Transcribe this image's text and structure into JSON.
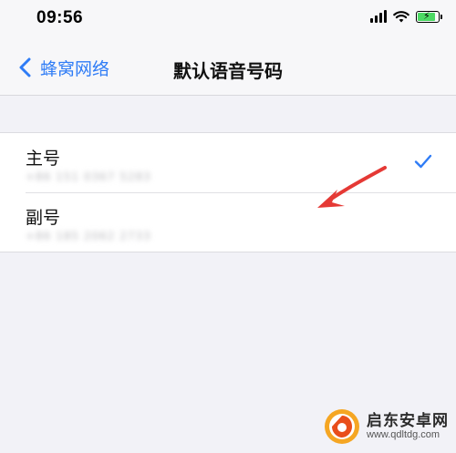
{
  "status_bar": {
    "time": "09:56"
  },
  "nav": {
    "back_label": "蜂窝网络",
    "title": "默认语音号码"
  },
  "lines": [
    {
      "title": "主号",
      "number": "+86 151 0367 5283",
      "selected": true
    },
    {
      "title": "副号",
      "number": "+86 185 2062 2733",
      "selected": false
    }
  ],
  "colors": {
    "accent": "#2f7cf6",
    "arrow": "#e53935",
    "background": "#f2f2f7"
  },
  "watermark": {
    "name": "启东安卓网",
    "url": "www.qdltdg.com"
  }
}
